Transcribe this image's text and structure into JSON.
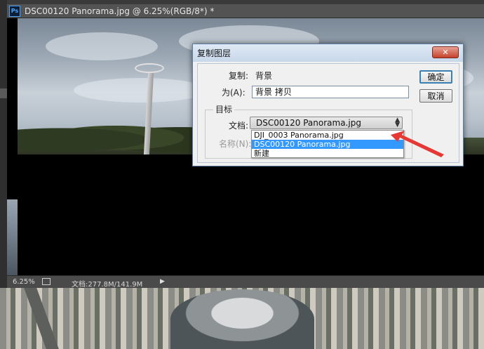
{
  "app": {
    "icon": "photoshop-icon",
    "icon_text": "Ps"
  },
  "document": {
    "tab_title": "DSC00120 Panorama.jpg @ 6.25%(RGB/8*) *",
    "zoom": "6.25%",
    "doc_info": "文档:277.8M/141.9M"
  },
  "dialog": {
    "title": "复制图层",
    "close_label": "✕",
    "copy_label": "复制:",
    "copy_value": "背景",
    "as_label": "为(A):",
    "as_value": "背景 拷贝",
    "ok_label": "确定",
    "cancel_label": "取消",
    "target_group_label": "目标",
    "document_label": "文档:",
    "document_selected": "DSC00120 Panorama.jpg",
    "name_label": "名称(N):",
    "document_options": [
      {
        "label": "DJI_0003 Panorama.jpg",
        "selected": false
      },
      {
        "label": "DSC00120 Panorama.jpg",
        "selected": true
      },
      {
        "label": "新建",
        "selected": false
      }
    ]
  },
  "colors": {
    "highlight": "#3399ff",
    "annotation_arrow": "#e53935",
    "ps_workspace": "#535353"
  }
}
